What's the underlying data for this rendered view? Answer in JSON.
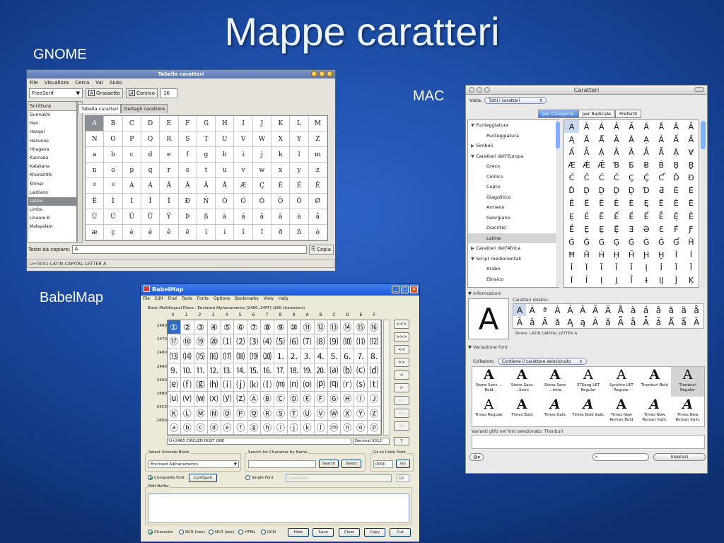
{
  "slide": {
    "title": "Mappe caratteri",
    "labels": {
      "gnome": "GNOME",
      "mac": "MAC",
      "babelmap": "BabelMap"
    }
  },
  "gnome": {
    "window_title": "Tabella caratteri",
    "menu": [
      "File",
      "Visualizza",
      "Cerca",
      "Vai",
      "Aiuto"
    ],
    "font_family": "FreeSerif",
    "bold_label": "Grassetto",
    "italic_label": "Corsivo",
    "font_size": "16",
    "scripts_header": "Scrittura",
    "scripts": [
      "Gurmukhi",
      "Han",
      "Hangul",
      "Hanunoo",
      "Hiragana",
      "Kannada",
      "Katakana",
      "Kharoshthi",
      "Khmer",
      "Laotiano",
      "Latino",
      "Limbu",
      "Lineare B",
      "Malayalam"
    ],
    "selected_script": "Latino",
    "tabs": [
      "Tabella caratteri",
      "Dettagli carattere"
    ],
    "grid": [
      [
        "A",
        "B",
        "C",
        "D",
        "E",
        "F",
        "G",
        "H",
        "I",
        "J",
        "K",
        "L",
        "M"
      ],
      [
        "N",
        "O",
        "P",
        "Q",
        "R",
        "S",
        "T",
        "U",
        "V",
        "W",
        "X",
        "Y",
        "Z"
      ],
      [
        "a",
        "b",
        "c",
        "d",
        "e",
        "f",
        "g",
        "h",
        "i",
        "j",
        "k",
        "l",
        "m"
      ],
      [
        "n",
        "o",
        "p",
        "q",
        "r",
        "s",
        "t",
        "u",
        "v",
        "w",
        "x",
        "y",
        "z"
      ],
      [
        "ª",
        "º",
        "À",
        "Á",
        "Â",
        "Ã",
        "Ä",
        "Å",
        "Æ",
        "Ç",
        "È",
        "É",
        "Ê"
      ],
      [
        "Ë",
        "Ì",
        "Í",
        "Î",
        "Ï",
        "Ð",
        "Ñ",
        "Ò",
        "Ó",
        "Ô",
        "Õ",
        "Ö",
        "Ø"
      ],
      [
        "Ù",
        "Ú",
        "Û",
        "Ü",
        "Ý",
        "Þ",
        "ß",
        "à",
        "á",
        "â",
        "ã",
        "ä",
        "å"
      ],
      [
        "æ",
        "ç",
        "è",
        "é",
        "ê",
        "ë",
        "ì",
        "í",
        "î",
        "ï",
        "ð",
        "ñ",
        "ò"
      ]
    ],
    "copy_label": "Testo da copiare:",
    "copy_value": "A",
    "copy_button": "Copia",
    "status": "U+0041 LATIN CAPITAL LETTER A"
  },
  "mac": {
    "window_title": "Caratteri",
    "vista_label": "Vista:",
    "vista_value": "Tutti i caratteri",
    "segments": [
      "per Categoria",
      "per Radicale",
      "Preferiti"
    ],
    "categories": [
      {
        "label": "Punteggiatura",
        "level": 0,
        "arrow": "▼"
      },
      {
        "label": "Punteggiatura",
        "level": 1,
        "arrow": ""
      },
      {
        "label": "Simboli",
        "level": 0,
        "arrow": "▶"
      },
      {
        "label": "Caratteri dell'Europa",
        "level": 0,
        "arrow": "▼"
      },
      {
        "label": "Greco",
        "level": 1,
        "arrow": ""
      },
      {
        "label": "Cirillico",
        "level": 1,
        "arrow": ""
      },
      {
        "label": "Copto",
        "level": 1,
        "arrow": ""
      },
      {
        "label": "Glagolitico",
        "level": 1,
        "arrow": ""
      },
      {
        "label": "Armeno",
        "level": 1,
        "arrow": ""
      },
      {
        "label": "Georgiano",
        "level": 1,
        "arrow": ""
      },
      {
        "label": "Diacritici",
        "level": 1,
        "arrow": ""
      },
      {
        "label": "Latina",
        "level": 1,
        "arrow": ""
      },
      {
        "label": "Caratteri dell'Africa",
        "level": 0,
        "arrow": "▶"
      },
      {
        "label": "Script mediorientali",
        "level": 0,
        "arrow": "▼"
      },
      {
        "label": "Arabo",
        "level": 1,
        "arrow": ""
      },
      {
        "label": "Ebraico",
        "level": 1,
        "arrow": ""
      }
    ],
    "selected_category": "Latina",
    "grid": [
      [
        "A",
        "À",
        "Á",
        "Â",
        "Ã",
        "Ä",
        "Å",
        "Ā",
        "Ă"
      ],
      [
        "Ą",
        "Ǎ",
        "Ǻ",
        "Ȁ",
        "Ȃ",
        "Ạ",
        "Ả",
        "Ấ",
        "Ầ"
      ],
      [
        "Ẩ",
        "Ẫ",
        "Ậ",
        "Ắ",
        "Ằ",
        "Ẳ",
        "Ẵ",
        "Ặ",
        "Ɐ"
      ],
      [
        "Æ",
        "Ǽ",
        "Ǣ",
        "Ɓ",
        "Ƃ",
        "Ƀ",
        "Ḃ",
        "Ḅ",
        "Ḇ"
      ],
      [
        "Ć",
        "Ĉ",
        "Ċ",
        "Č",
        "Ç",
        "Ḉ",
        "Ƈ",
        "Ď",
        "Đ"
      ],
      [
        "Ḋ",
        "Ḍ",
        "Ḏ",
        "Ḑ",
        "Ḓ",
        "Ɗ",
        "Ƌ",
        "È",
        "É"
      ],
      [
        "Ê",
        "Ë",
        "Ē",
        "Ĕ",
        "Ė",
        "Ę",
        "Ě",
        "Ȅ",
        "Ȇ"
      ],
      [
        "Ẹ",
        "Ẻ",
        "Ẽ",
        "Ế",
        "Ề",
        "Ể",
        "Ễ",
        "Ệ",
        "Ḕ"
      ],
      [
        "Ḗ",
        "Ḙ",
        "Ḛ",
        "Ḝ",
        "Ǝ",
        "Ə",
        "Ɛ",
        "Ḟ",
        "Ƒ"
      ],
      [
        "Ĝ",
        "Ğ",
        "Ġ",
        "Ģ",
        "Ǧ",
        "Ǵ",
        "Ḡ",
        "Ɠ",
        "Ĥ"
      ],
      [
        "Ħ",
        "Ȟ",
        "Ḣ",
        "Ḥ",
        "Ḧ",
        "Ḩ",
        "Ḫ",
        "Ì",
        "Í"
      ],
      [
        "Î",
        "Ï",
        "Ĩ",
        "Ī",
        "Ĭ",
        "Į",
        "İ",
        "Ǐ",
        "Ȉ"
      ],
      [
        "Ȋ",
        "Ỉ",
        "Ị",
        "Ḭ",
        "Ḯ",
        "Ɨ",
        "Ĳ",
        "Ĵ",
        "Ķ"
      ]
    ],
    "info_header": "Informazioni",
    "info_char": "A",
    "related_label": "Caratteri relativi:",
    "related": [
      [
        "A",
        "À",
        "ª",
        "À",
        "Á",
        "Â",
        "Ã",
        "Ä",
        "Å",
        "à",
        "á",
        "â",
        "ã",
        "ä",
        "å"
      ],
      [
        "Ā",
        "ā",
        "Ă",
        "ă",
        "Ą",
        "ą",
        "Ǎ",
        "ǎ",
        "Ǟ",
        "ǟ",
        "Ǡ",
        "ǡ",
        "Ǻ",
        "ǻ",
        "Ȁ"
      ]
    ],
    "name_line": "Nome: LATIN CAPITAL LETTER A",
    "variation_header": "Variazione font",
    "collection_label": "Collezioni:",
    "collection_value": "Contiene il carattere selezionato",
    "fonts": [
      {
        "glyph": "A",
        "name": "Stone Sans ... Bold"
      },
      {
        "glyph": "A",
        "name": "Stone Sans ...Semi"
      },
      {
        "glyph": "A",
        "name": "Stone Sans ...mita"
      },
      {
        "glyph": "A",
        "name": "STSong LET Regular"
      },
      {
        "glyph": "A",
        "name": "Synchro LET Regular"
      },
      {
        "glyph": "A",
        "name": "Thonburi Bold"
      },
      {
        "glyph": "A",
        "name": "Thonburi Regular"
      },
      {
        "glyph": "A",
        "name": "Times Regular"
      },
      {
        "glyph": "A",
        "name": "Times Bold"
      },
      {
        "glyph": "A",
        "name": "Times Italic"
      },
      {
        "glyph": "A",
        "name": "Times Bold Italic"
      },
      {
        "glyph": "A",
        "name": "Times New Roman Bold"
      },
      {
        "glyph": "A",
        "name": "Times New Roman Italic"
      },
      {
        "glyph": "A",
        "name": "Times New Roman Italic"
      }
    ],
    "selected_font": "Thonburi Regular",
    "variants_label": "Varianti glifo nel font selezionato: Thonburi",
    "insert_button": "Inserisci"
  },
  "babelmap": {
    "window_title": "BabelMap",
    "menu": [
      "File",
      "Edit",
      "Find",
      "Tools",
      "Fonts",
      "Options",
      "Bookmarks",
      "View",
      "Help"
    ],
    "plane_label": "Basic Multilingual Plane : Enclosed Alphanumerics [2460..24FF] (160 characters)",
    "columns": [
      "0",
      "1",
      "2",
      "3",
      "4",
      "5",
      "6",
      "7",
      "8",
      "9",
      "A",
      "B",
      "C",
      "D",
      "E",
      "F"
    ],
    "rows": [
      "2460",
      "2470",
      "2480",
      "2490",
      "24A0",
      "24B0",
      "24C0",
      "24D0"
    ],
    "grid": [
      [
        "①",
        "②",
        "③",
        "④",
        "⑤",
        "⑥",
        "⑦",
        "⑧",
        "⑨",
        "⑩",
        "⑪",
        "⑫",
        "⑬",
        "⑭",
        "⑮",
        "⑯"
      ],
      [
        "⑰",
        "⑱",
        "⑲",
        "⑳",
        "⑴",
        "⑵",
        "⑶",
        "⑷",
        "⑸",
        "⑹",
        "⑺",
        "⑻",
        "⑼",
        "⑽",
        "⑾",
        "⑿"
      ],
      [
        "⒀",
        "⒁",
        "⒂",
        "⒃",
        "⒄",
        "⒅",
        "⒆",
        "⒇",
        "⒈",
        "⒉",
        "⒊",
        "⒋",
        "⒌",
        "⒍",
        "⒎",
        "⒏"
      ],
      [
        "⒐",
        "⒑",
        "⒒",
        "⒓",
        "⒔",
        "⒕",
        "⒖",
        "⒗",
        "⒘",
        "⒙",
        "⒚",
        "⒛",
        "⒜",
        "⒝",
        "⒞",
        "⒟"
      ],
      [
        "⒠",
        "⒡",
        "⒢",
        "⒣",
        "⒤",
        "⒥",
        "⒦",
        "⒧",
        "⒨",
        "⒩",
        "⒪",
        "⒫",
        "⒬",
        "⒭",
        "⒮",
        "⒯"
      ],
      [
        "⒰",
        "⒱",
        "⒲",
        "⒳",
        "⒴",
        "⒵",
        "Ⓐ",
        "Ⓑ",
        "Ⓒ",
        "Ⓓ",
        "Ⓔ",
        "Ⓕ",
        "Ⓖ",
        "Ⓗ",
        "Ⓘ",
        "Ⓙ"
      ],
      [
        "Ⓚ",
        "Ⓛ",
        "Ⓜ",
        "Ⓝ",
        "Ⓞ",
        "Ⓟ",
        "Ⓠ",
        "Ⓡ",
        "Ⓢ",
        "Ⓣ",
        "Ⓤ",
        "Ⓥ",
        "Ⓦ",
        "Ⓧ",
        "Ⓨ",
        "Ⓩ"
      ],
      [
        "ⓐ",
        "ⓑ",
        "ⓒ",
        "ⓓ",
        "ⓔ",
        "ⓕ",
        "ⓖ",
        "ⓗ",
        "ⓘ",
        "ⓙ",
        "ⓚ",
        "ⓛ",
        "ⓜ",
        "ⓝ",
        "ⓞ",
        "ⓟ"
      ]
    ],
    "nav_buttons": [
      "<<<",
      ">>>",
      "<<",
      ">>",
      "<",
      ">",
      "<<",
      ">>",
      "VS"
    ],
    "char_info": "U+2460 CIRCLED DIGIT ONE",
    "decimal": "Decimal 9312",
    "help_button": "?",
    "block_group": "Select Unicode Block",
    "block_value": "Enclosed Alphanumerics",
    "search_group": "Search for Character by Name",
    "search_button": "Search",
    "select_button": "Select",
    "goto_group": "Go to Code Point",
    "goto_value": "0000",
    "go_button": "Go",
    "composite_font": "Composite Font",
    "configure_button": "Configure",
    "single_font": "Single Font",
    "single_font_value": "Code2000",
    "font_size": "16",
    "edit_buffer": "Edit Buffer",
    "radios": [
      "Character",
      "NCR (hex)",
      "NCR (dec)",
      "HTML",
      "UCN"
    ],
    "buttons": [
      "Hide",
      "Save",
      "Clear",
      "Copy",
      "Cut"
    ]
  }
}
